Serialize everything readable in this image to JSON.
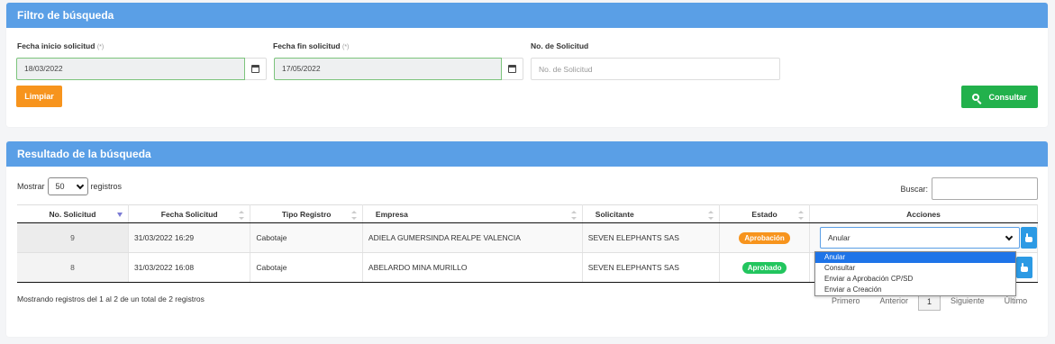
{
  "filter": {
    "title": "Filtro de búsqueda",
    "fecha_inicio_label": "Fecha inicio solicitud",
    "fecha_inicio_value": "18/03/2022",
    "fecha_fin_label": "Fecha fin solicitud",
    "fecha_fin_value": "17/05/2022",
    "required_mark": "(*)",
    "no_solicitud_label": "No. de Solicitud",
    "no_solicitud_placeholder": "No. de Solicitud",
    "limpiar": "Limpiar",
    "consultar": "Consultar"
  },
  "results": {
    "title": "Resultado de la búsqueda",
    "mostrar": "Mostrar",
    "page_length": "50",
    "registros": "registros",
    "buscar": "Buscar:",
    "columns": [
      "No. Solicitud",
      "Fecha Solicitud",
      "Tipo Registro",
      "Empresa",
      "Solicitante",
      "Estado",
      "Acciones"
    ],
    "rows": [
      {
        "num": "9",
        "fecha": "31/03/2022 16:29",
        "tipo": "Cabotaje",
        "empresa": "ADIELA GUMERSINDA REALPE VALENCIA",
        "solicitante": "SEVEN ELEPHANTS SAS",
        "estado": "Aprobación",
        "accion": "Anular"
      },
      {
        "num": "8",
        "fecha": "31/03/2022 16:08",
        "tipo": "Cabotaje",
        "empresa": "ABELARDO MINA MURILLO",
        "solicitante": "SEVEN ELEPHANTS SAS",
        "estado": "Aprobado",
        "accion": ""
      }
    ],
    "dropdown_options": [
      "Anular",
      "Consultar",
      "Enviar a Aprobación CP/SD",
      "Enviar a Creación"
    ],
    "info": "Mostrando registros del 1 al 2 de un total de 2 registros",
    "pager": {
      "first": "Primero",
      "prev": "Anterior",
      "current": "1",
      "next": "Siguiente",
      "last": "Último"
    }
  },
  "colors": {
    "header": "#5a9fe6",
    "orange": "#f7941d",
    "green": "#22b14c",
    "select_blue": "#1e74e8"
  }
}
